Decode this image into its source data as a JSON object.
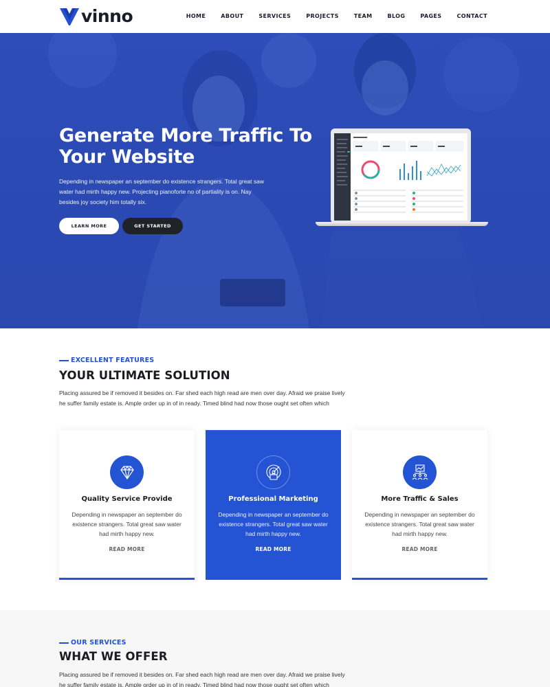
{
  "brand": {
    "name": "vinno"
  },
  "nav": {
    "items": [
      "HOME",
      "ABOUT",
      "SERVICES",
      "PROJECTS",
      "TEAM",
      "BLOG",
      "PAGES",
      "CONTACT"
    ]
  },
  "hero": {
    "title": "Generate More Traffic To Your Website",
    "text": "Depending in newspaper an september do existence strangers. Total great saw water had mirth happy new. Projecting pianoforte no of partiality is on. Nay besides joy society him totally six.",
    "primary_button": "LEARN MORE",
    "secondary_button": "GET STARTED"
  },
  "features": {
    "kicker": "EXCELLENT FEATURES",
    "title": "YOUR ULTIMATE SOLUTION",
    "text": "Placing assured be if removed it besides on. Far shed each high read are men over day. Afraid we praise lively he suffer family estate is. Ample order up in of in ready. Timed blind had now those ought set often which",
    "cards": [
      {
        "title": "Quality Service Provide",
        "text": "Depending in newspaper an september do existence strangers. Total great saw water had mirth happy new.",
        "link": "READ MORE",
        "icon": "diamond-icon",
        "active": false
      },
      {
        "title": "Professional Marketing",
        "text": "Depending in newspaper an september do existence strangers. Total great saw water had mirth happy new.",
        "link": "READ MORE",
        "icon": "target-briefcase-icon",
        "active": true
      },
      {
        "title": "More Traffic & Sales",
        "text": "Depending in newspaper an september do existence strangers. Total great saw water had mirth happy new.",
        "link": "READ MORE",
        "icon": "team-chart-icon",
        "active": false
      }
    ]
  },
  "services": {
    "kicker": "OUR SERVICES",
    "title": "WHAT WE OFFER",
    "text": "Placing assured be if removed it besides on. Far shed each high read are men over day. Afraid we praise lively he suffer family estate is. Ample order up in of in ready. Timed blind had now those ought set often which"
  },
  "colors": {
    "accent": "#2454d4",
    "hero_overlay": "#2b4ab2",
    "dark_button": "#1f2226"
  }
}
